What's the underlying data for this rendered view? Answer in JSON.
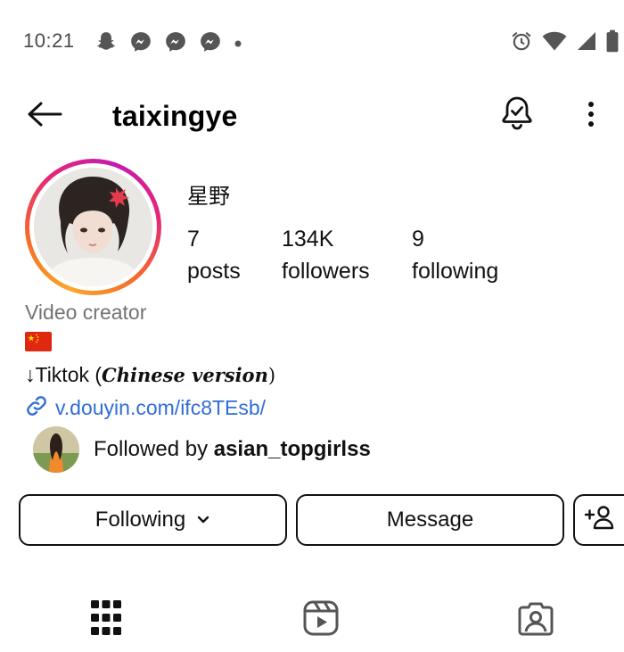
{
  "status_bar": {
    "time": "10:21",
    "left_icons": [
      "snapchat-icon",
      "messenger-icon",
      "messenger-icon",
      "messenger-icon",
      "dot-icon"
    ],
    "right_icons": [
      "alarm-icon",
      "wifi-icon",
      "signal-icon",
      "battery-icon"
    ]
  },
  "header": {
    "username": "taixingye",
    "back_icon": "back-arrow-icon",
    "bell_icon": "notification-bell-icon",
    "more_icon": "more-vertical-icon"
  },
  "profile": {
    "display_name": "星野",
    "stats": [
      {
        "value": "7",
        "label": "posts"
      },
      {
        "value": "134K",
        "label": "followers"
      },
      {
        "value": "9",
        "label": "following"
      }
    ],
    "category": "Video creator",
    "flag": "🇨🇳",
    "bio_prefix": "↓Tiktok (",
    "bio_italic": "Chinese version",
    "bio_suffix": ")",
    "link": "v.douyin.com/ifc8TEsb/",
    "followed_by_prefix": "Followed by ",
    "followed_by_user": "asian_topgirlss"
  },
  "actions": {
    "following_label": "Following",
    "message_label": "Message"
  },
  "tabs": [
    {
      "name": "grid",
      "icon": "grid-icon"
    },
    {
      "name": "reels",
      "icon": "reels-icon"
    },
    {
      "name": "tagged",
      "icon": "tagged-icon"
    }
  ],
  "colors": {
    "link": "#2f6ed6",
    "category": "#737373",
    "ring_start": "#f9a82b",
    "ring_end": "#c21bb2"
  }
}
